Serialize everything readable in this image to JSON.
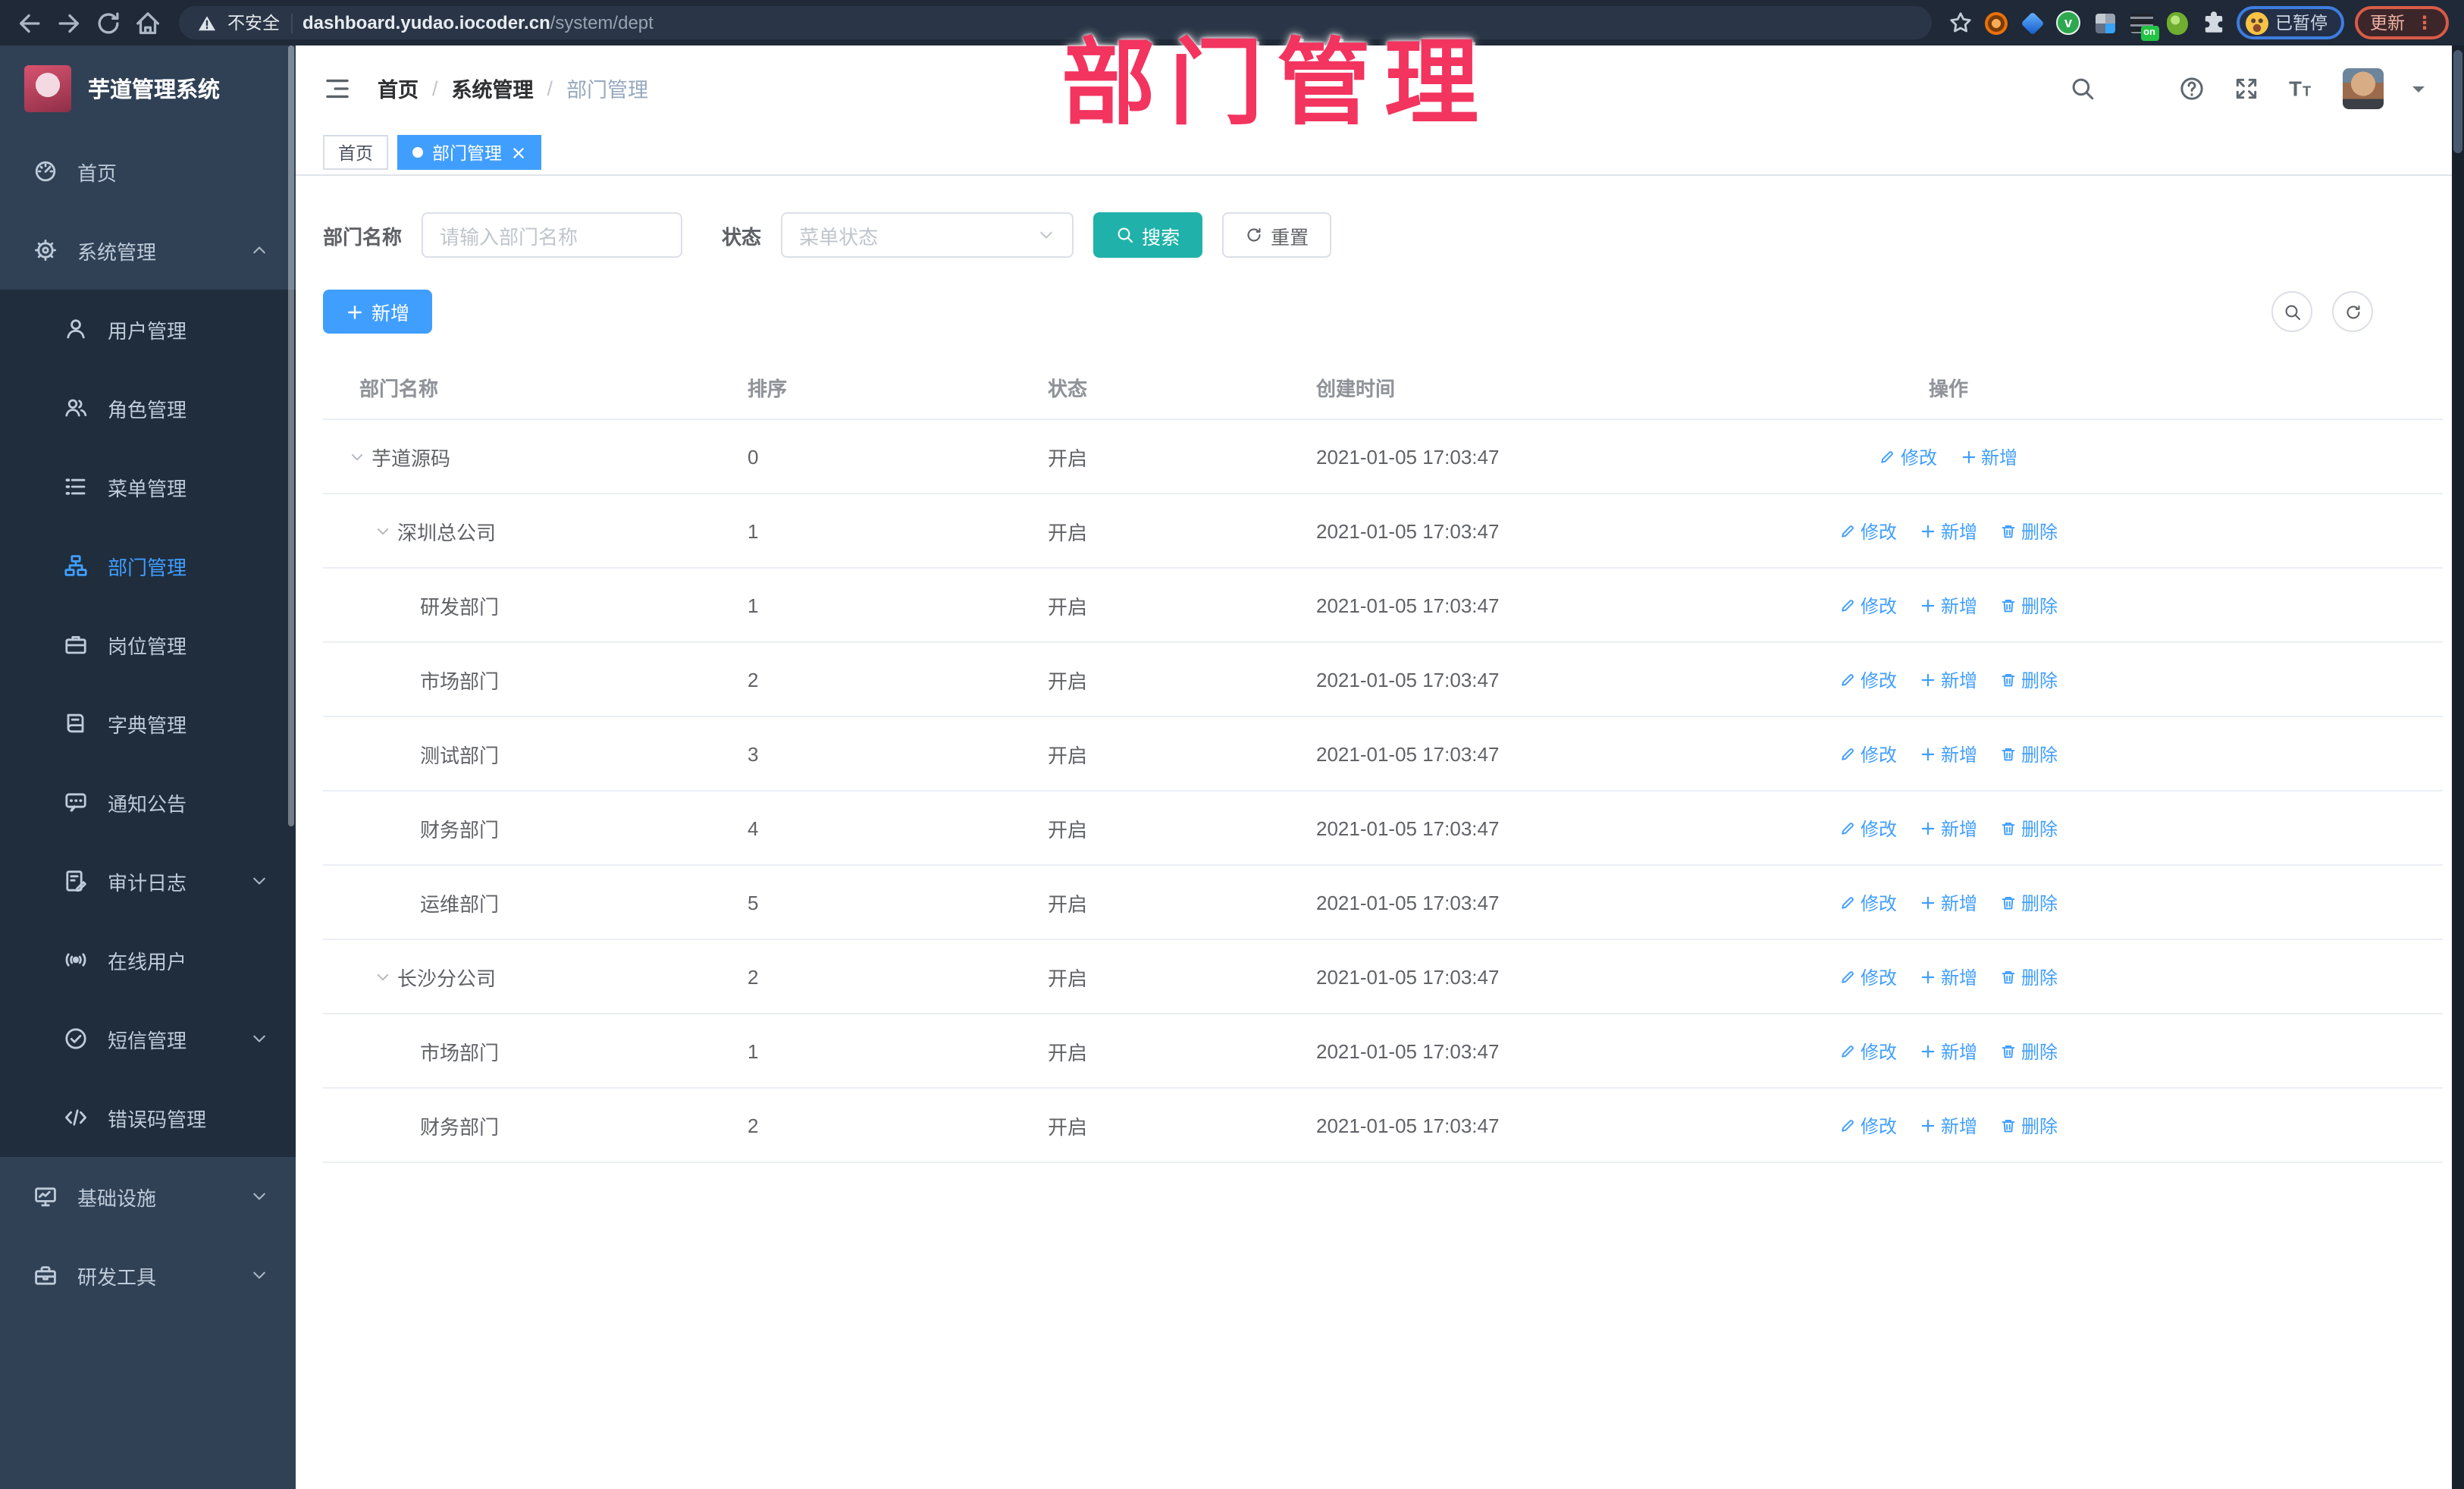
{
  "watermark": "部门管理",
  "colors": {
    "accent": "#409eff",
    "search_teal": "#20b2aa",
    "watermark_pink": "#f2345f",
    "sidebar_bg": "#304156",
    "submenu_bg": "#1f2d3d"
  },
  "browser": {
    "security_label": "不安全",
    "url_host": "dashboard.yudao.iocoder.cn",
    "url_path": "/system/dept",
    "on_badge_label": "on",
    "paused_label": "已暂停",
    "update_label": "更新",
    "update_dots": "⋮"
  },
  "sidebar": {
    "title": "芋道管理系统",
    "menu": [
      {
        "label": "首页",
        "icon": "dashboard-icon",
        "level": 0
      },
      {
        "label": "系统管理",
        "icon": "gear-icon",
        "level": 0,
        "expandable": true,
        "expanded": true
      },
      {
        "label": "用户管理",
        "icon": "user-icon",
        "level": 1
      },
      {
        "label": "角色管理",
        "icon": "users-icon",
        "level": 1
      },
      {
        "label": "菜单管理",
        "icon": "menu-tree-icon",
        "level": 1
      },
      {
        "label": "部门管理",
        "icon": "org-tree-icon",
        "level": 1,
        "active": true
      },
      {
        "label": "岗位管理",
        "icon": "briefcase-icon",
        "level": 1
      },
      {
        "label": "字典管理",
        "icon": "dictionary-icon",
        "level": 1
      },
      {
        "label": "通知公告",
        "icon": "announcement-icon",
        "level": 1
      },
      {
        "label": "审计日志",
        "icon": "audit-log-icon",
        "level": 1,
        "expandable": true
      },
      {
        "label": "在线用户",
        "icon": "online-users-icon",
        "level": 1
      },
      {
        "label": "短信管理",
        "icon": "sms-icon",
        "level": 1,
        "expandable": true
      },
      {
        "label": "错误码管理",
        "icon": "error-code-icon",
        "level": 1
      },
      {
        "label": "基础设施",
        "icon": "infrastructure-icon",
        "level": 0,
        "expandable": true
      },
      {
        "label": "研发工具",
        "icon": "devtools-icon",
        "level": 0,
        "expandable": true
      }
    ]
  },
  "header": {
    "breadcrumb": [
      "首页",
      "系统管理",
      "部门管理"
    ]
  },
  "tabs": [
    {
      "label": "首页",
      "active": false
    },
    {
      "label": "部门管理",
      "active": true,
      "closable": true
    }
  ],
  "filters": {
    "name_label": "部门名称",
    "name_placeholder": "请输入部门名称",
    "status_label": "状态",
    "status_placeholder": "菜单状态",
    "search_label": "搜索",
    "reset_label": "重置"
  },
  "toolbar": {
    "add_label": "新增"
  },
  "table": {
    "columns": [
      "部门名称",
      "排序",
      "状态",
      "创建时间",
      "操作"
    ],
    "action_labels": {
      "modify": "修改",
      "add": "新增",
      "delete": "删除"
    },
    "rows": [
      {
        "name": "芋道源码",
        "level": 0,
        "expandable": true,
        "sort": "0",
        "status": "开启",
        "created": "2021-01-05 17:03:47",
        "actions": [
          "modify",
          "add"
        ]
      },
      {
        "name": "深圳总公司",
        "level": 1,
        "expandable": true,
        "sort": "1",
        "status": "开启",
        "created": "2021-01-05 17:03:47",
        "actions": [
          "modify",
          "add",
          "delete"
        ]
      },
      {
        "name": "研发部门",
        "level": 2,
        "expandable": false,
        "sort": "1",
        "status": "开启",
        "created": "2021-01-05 17:03:47",
        "actions": [
          "modify",
          "add",
          "delete"
        ]
      },
      {
        "name": "市场部门",
        "level": 2,
        "expandable": false,
        "sort": "2",
        "status": "开启",
        "created": "2021-01-05 17:03:47",
        "actions": [
          "modify",
          "add",
          "delete"
        ]
      },
      {
        "name": "测试部门",
        "level": 2,
        "expandable": false,
        "sort": "3",
        "status": "开启",
        "created": "2021-01-05 17:03:47",
        "actions": [
          "modify",
          "add",
          "delete"
        ]
      },
      {
        "name": "财务部门",
        "level": 2,
        "expandable": false,
        "sort": "4",
        "status": "开启",
        "created": "2021-01-05 17:03:47",
        "actions": [
          "modify",
          "add",
          "delete"
        ]
      },
      {
        "name": "运维部门",
        "level": 2,
        "expandable": false,
        "sort": "5",
        "status": "开启",
        "created": "2021-01-05 17:03:47",
        "actions": [
          "modify",
          "add",
          "delete"
        ]
      },
      {
        "name": "长沙分公司",
        "level": 1,
        "expandable": true,
        "sort": "2",
        "status": "开启",
        "created": "2021-01-05 17:03:47",
        "actions": [
          "modify",
          "add",
          "delete"
        ]
      },
      {
        "name": "市场部门",
        "level": 2,
        "expandable": false,
        "sort": "1",
        "status": "开启",
        "created": "2021-01-05 17:03:47",
        "actions": [
          "modify",
          "add",
          "delete"
        ]
      },
      {
        "name": "财务部门",
        "level": 2,
        "expandable": false,
        "sort": "2",
        "status": "开启",
        "created": "2021-01-05 17:03:47",
        "actions": [
          "modify",
          "add",
          "delete"
        ]
      }
    ]
  }
}
